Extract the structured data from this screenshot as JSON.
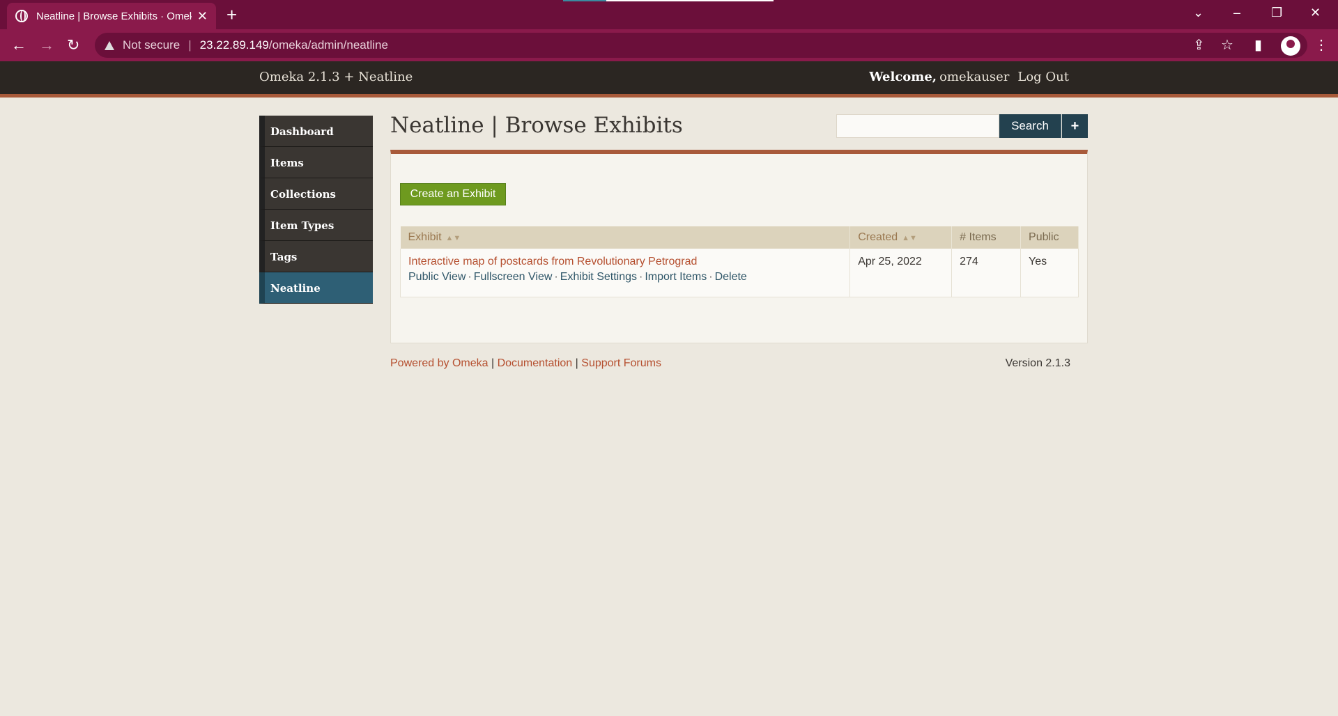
{
  "browser": {
    "tab_title": "Neatline | Browse Exhibits · Omek",
    "address_warning": "Not secure",
    "url_host": "23.22.89.149",
    "url_path": "/omeka/admin/neatline"
  },
  "header": {
    "site_title": "Omeka 2.1.3 + Neatline",
    "welcome_label": "Welcome,",
    "username": "omekauser",
    "logout_label": "Log Out"
  },
  "sidebar": {
    "items": [
      {
        "label": "Dashboard"
      },
      {
        "label": "Items"
      },
      {
        "label": "Collections"
      },
      {
        "label": "Item Types"
      },
      {
        "label": "Tags"
      },
      {
        "label": "Neatline"
      }
    ]
  },
  "main": {
    "title": "Neatline | Browse Exhibits",
    "search_button": "Search",
    "advanced_search": "+",
    "create_button": "Create an Exhibit",
    "table": {
      "columns": [
        "Exhibit",
        "Created",
        "# Items",
        "Public"
      ],
      "rows": [
        {
          "title": "Interactive map of postcards from Revolutionary Petrograd",
          "actions": [
            "Public View",
            "Fullscreen View",
            "Exhibit Settings",
            "Import Items",
            "Delete"
          ],
          "created": "Apr 25, 2022",
          "items": "274",
          "public": "Yes"
        }
      ]
    }
  },
  "footer": {
    "powered_by": "Powered by Omeka",
    "documentation": "Documentation",
    "support": "Support Forums",
    "separator": "|",
    "version": "Version 2.1.3"
  },
  "colors": {
    "browser_frame": "#6b0f3a",
    "header_bg": "#2b2622",
    "accent_rule": "#a85a3a",
    "active_nav": "#2e5f75",
    "create_button": "#6e9a1f",
    "link": "#b54f2f"
  }
}
